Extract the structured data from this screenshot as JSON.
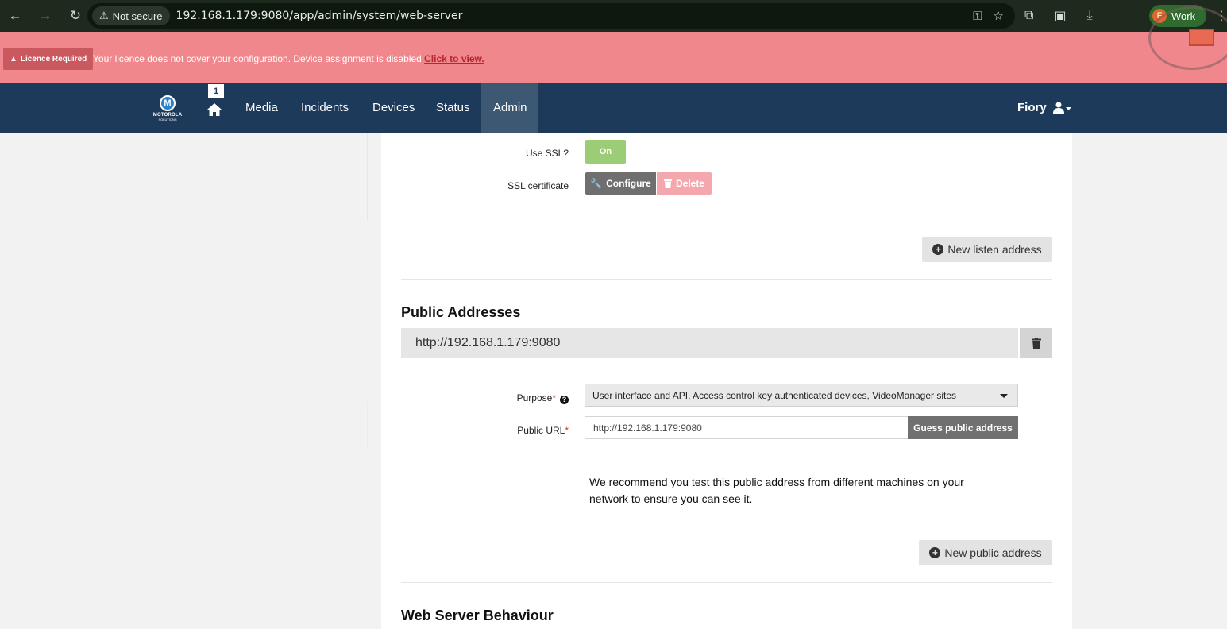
{
  "browser": {
    "security_label": "Not secure",
    "url": "192.168.1.179:9080/app/admin/system/web-server",
    "profile_initial": "F",
    "profile_name": "Work"
  },
  "licence": {
    "badge": "Licence Required",
    "message": "Your licence does not cover your configuration. Device assignment is disabled",
    "link": "Click to view."
  },
  "nav": {
    "home_badge": "1",
    "items": [
      "Media",
      "Incidents",
      "Devices",
      "Status",
      "Admin"
    ],
    "active": "Admin",
    "user": "Fiory",
    "logo_text": "MOTOROLA",
    "logo_sub": "SOLUTIONS"
  },
  "ssl": {
    "use_ssl_label": "Use SSL?",
    "use_ssl_value": "On",
    "certificate_label": "SSL certificate",
    "configure_label": "Configure",
    "delete_label": "Delete"
  },
  "listen": {
    "new_button": "New listen address"
  },
  "public_addresses": {
    "title": "Public Addresses",
    "entries": [
      {
        "address": "http://192.168.1.179:9080",
        "purpose_label": "Purpose",
        "purpose_value": "User interface and API, Access control key authenticated devices, VideoManager sites",
        "url_label": "Public URL",
        "url_value": "http://192.168.1.179:9080",
        "guess_button": "Guess public address",
        "recommendation": "We recommend you test this public address from different machines on your network to ensure you can see it."
      }
    ],
    "new_button": "New public address"
  },
  "behaviour": {
    "title": "Web Server Behaviour"
  },
  "colors": {
    "banner": "#f0878d",
    "nav": "#1e3a5a",
    "nav_active": "#3d5873",
    "ssl_on": "#9dcc77",
    "delete_disabled": "#f4a7ad"
  }
}
